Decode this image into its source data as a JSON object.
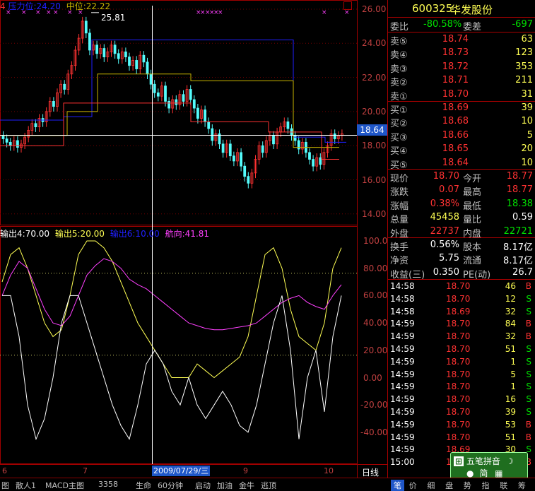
{
  "indicators_top": {
    "prefix": "4",
    "pressure_label": "压力位:24.20",
    "mid_label": "中位:22.22",
    "peak_label": "25.81"
  },
  "indicators_bottom": {
    "out4": "输出4:70.00",
    "out5": "输出5:20.00",
    "out6": "输出6:10.00",
    "heading": "航向:41.81"
  },
  "price_axis": [
    "26.00",
    "24.00",
    "22.00",
    "20.00",
    "18.00",
    "16.00",
    "14.00"
  ],
  "current_price_tag": "18.64",
  "osc_axis": [
    "100.0",
    "80.00",
    "60.00",
    "40.00",
    "20.00",
    "0.00",
    "-20.00",
    "-40.00"
  ],
  "date_axis": [
    "6",
    "7",
    "8",
    "9",
    "10"
  ],
  "cursor_date": "2009/07/29/三",
  "period_label": "日线",
  "stock": {
    "code": "600325",
    "name": "华发股份"
  },
  "order_ratio": {
    "wb_label": "委比",
    "wb_value": "-80.58%",
    "wc_label": "委差",
    "wc_value": "-697"
  },
  "asks": [
    {
      "label": "卖⑤",
      "price": "18.74",
      "vol": "63"
    },
    {
      "label": "卖④",
      "price": "18.73",
      "vol": "123"
    },
    {
      "label": "卖③",
      "price": "18.72",
      "vol": "353"
    },
    {
      "label": "卖②",
      "price": "18.71",
      "vol": "211"
    },
    {
      "label": "卖①",
      "price": "18.70",
      "vol": "31"
    }
  ],
  "bids": [
    {
      "label": "买①",
      "price": "18.69",
      "vol": "39"
    },
    {
      "label": "买②",
      "price": "18.68",
      "vol": "10"
    },
    {
      "label": "买③",
      "price": "18.66",
      "vol": "5"
    },
    {
      "label": "买④",
      "price": "18.65",
      "vol": "20"
    },
    {
      "label": "买⑤",
      "price": "18.64",
      "vol": "10"
    }
  ],
  "quote": [
    {
      "l1": "现价",
      "v1": "18.70",
      "l2": "今开",
      "v2": "18.77"
    },
    {
      "l1": "涨跌",
      "v1": "0.07",
      "l2": "最高",
      "v2": "18.77"
    },
    {
      "l1": "涨幅",
      "v1": "0.38%",
      "l2": "最低",
      "v2": "18.38"
    },
    {
      "l1": "总量",
      "v1": "45458",
      "l2": "量比",
      "v2": "0.59"
    },
    {
      "l1": "外盘",
      "v1": "22737",
      "l2": "内盘",
      "v2": "22721"
    }
  ],
  "finance": [
    {
      "l1": "换手",
      "v1": "0.56%",
      "l2": "股本",
      "v2": "8.17亿"
    },
    {
      "l1": "净资",
      "v1": "5.75",
      "l2": "流通",
      "v2": "8.17亿"
    },
    {
      "l1": "收益(三)",
      "v1": "0.350",
      "l2": "PE(动)",
      "v2": "26.7"
    }
  ],
  "ticks": [
    {
      "time": "14:58",
      "price": "18.70",
      "vol": "46",
      "side": "B"
    },
    {
      "time": "14:58",
      "price": "18.70",
      "vol": "12",
      "side": "S"
    },
    {
      "time": "14:58",
      "price": "18.69",
      "vol": "32",
      "side": "S"
    },
    {
      "time": "14:59",
      "price": "18.70",
      "vol": "84",
      "side": "B"
    },
    {
      "time": "14:59",
      "price": "18.70",
      "vol": "32",
      "side": "B"
    },
    {
      "time": "14:59",
      "price": "18.70",
      "vol": "51",
      "side": "S"
    },
    {
      "time": "14:59",
      "price": "18.70",
      "vol": "1",
      "side": "S"
    },
    {
      "time": "14:59",
      "price": "18.70",
      "vol": "5",
      "side": "S"
    },
    {
      "time": "14:59",
      "price": "18.70",
      "vol": "1",
      "side": "S"
    },
    {
      "time": "14:59",
      "price": "18.70",
      "vol": "16",
      "side": "S"
    },
    {
      "time": "14:59",
      "price": "18.70",
      "vol": "39",
      "side": "S"
    },
    {
      "time": "14:59",
      "price": "18.70",
      "vol": "53",
      "side": "B"
    },
    {
      "time": "14:59",
      "price": "18.70",
      "vol": "51",
      "side": "B"
    },
    {
      "time": "14:59",
      "price": "18.69",
      "vol": "30",
      "side": "S"
    },
    {
      "time": "15:00",
      "price": "18.70",
      "vol": "",
      "side": "B"
    }
  ],
  "bottom_tabs": [
    "图",
    "散人1",
    "MACD主图",
    "3358",
    "生命",
    "60分钟",
    "启动",
    "加油",
    "金牛",
    "逃顶"
  ],
  "right_tabs": [
    "笔",
    "价",
    "细",
    "盘",
    "势",
    "指",
    "联",
    "筹"
  ],
  "ime": {
    "line1": "五笔拼音",
    "line2": "简"
  },
  "colors": {
    "up": "#ff3232",
    "down": "#54fcfc",
    "yellow": "#ffff54",
    "green": "#00ff00",
    "magenta": "#ff40ff",
    "blue": "#2020ff",
    "gold": "#c8b400"
  }
}
